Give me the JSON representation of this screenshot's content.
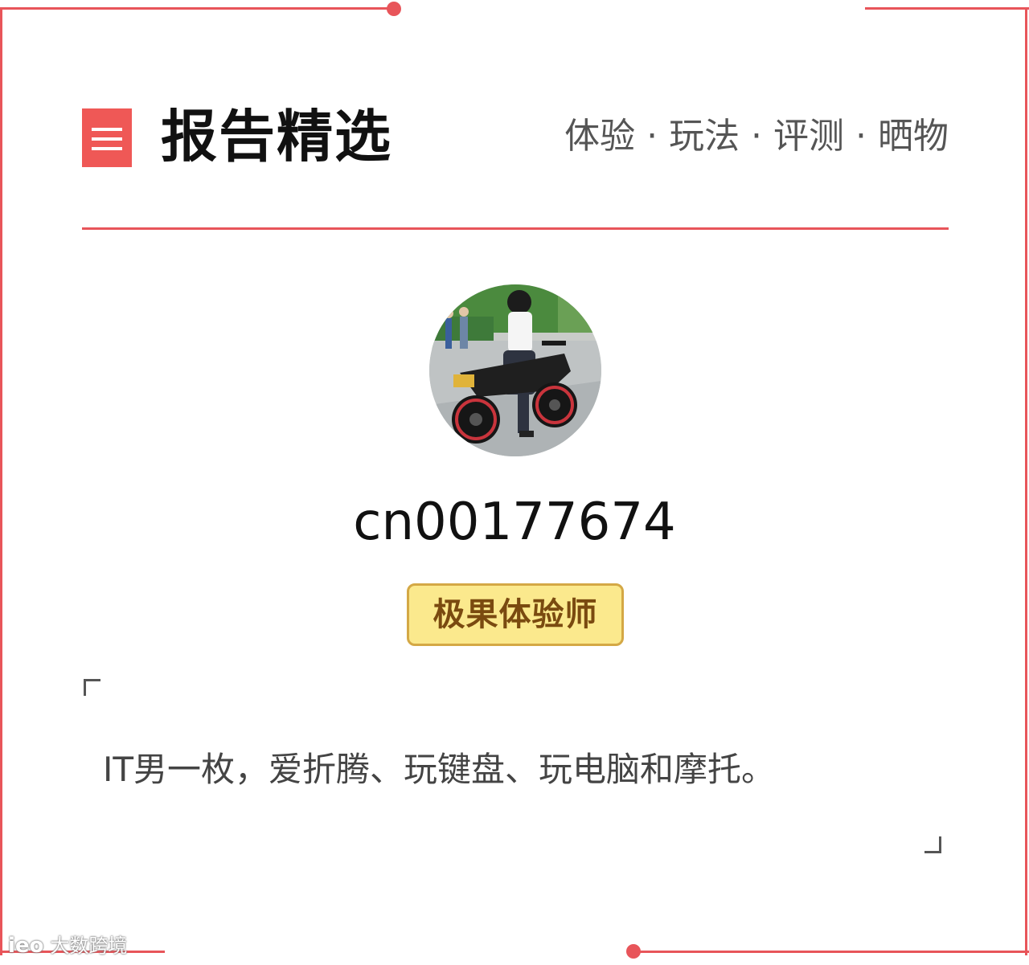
{
  "header": {
    "title": "报告精选",
    "tagline": "体验 · 玩法 · 评测 · 晒物"
  },
  "profile": {
    "username": "cn00177674",
    "badge": "极果体验师",
    "bio": "IT男一枚，爱折腾、玩键盘、玩电脑和摩托。"
  },
  "watermark": {
    "logo": "ieo",
    "text": "大数跨境"
  },
  "colors": {
    "accent": "#e8555a",
    "icon_bg": "#ef5856",
    "badge_bg": "#fbe98d",
    "badge_border": "#d4a845",
    "badge_text": "#7a4a10"
  },
  "icons": {
    "menu": "menu-icon",
    "avatar": "avatar-photo"
  }
}
